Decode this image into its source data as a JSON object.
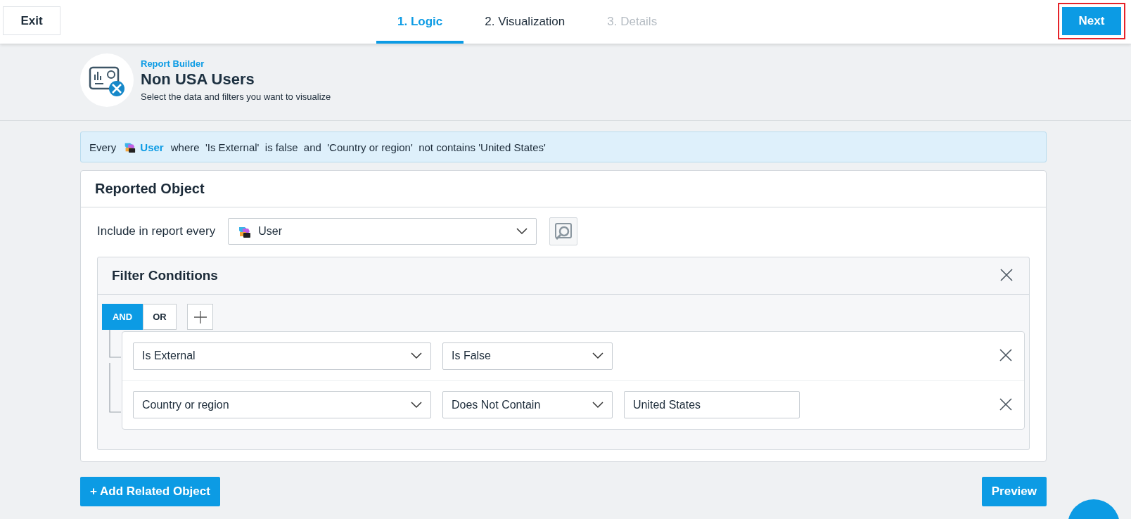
{
  "header": {
    "exit_label": "Exit",
    "next_label": "Next",
    "next_highlighted": true,
    "steps": [
      {
        "label": "1. Logic",
        "selected": true,
        "disabled": false
      },
      {
        "label": "2. Visualization",
        "selected": false,
        "disabled": false
      },
      {
        "label": "3. Details",
        "selected": false,
        "disabled": true
      }
    ]
  },
  "report": {
    "eyebrow": "Report Builder",
    "title": "Non USA Users",
    "subtitle": "Select the data and filters you want to visualize"
  },
  "summary": {
    "prefix": "Every",
    "object": "User",
    "condition": "where  'Is External'  is false  and  'Country or region'  not contains 'United States'"
  },
  "reported_object": {
    "title": "Reported Object",
    "include_label": "Include in report every",
    "object": "User",
    "filter": {
      "title": "Filter Conditions",
      "operators": [
        {
          "label": "AND",
          "selected": true
        },
        {
          "label": "OR",
          "selected": false
        }
      ],
      "conditions": [
        {
          "field": "Is External",
          "operator": "Is False"
        },
        {
          "field": "Country or region",
          "operator": "Does Not Contain",
          "value": "United States"
        }
      ]
    }
  },
  "actions": {
    "add_label": "+ Add Related Object",
    "preview_label": "Preview"
  }
}
